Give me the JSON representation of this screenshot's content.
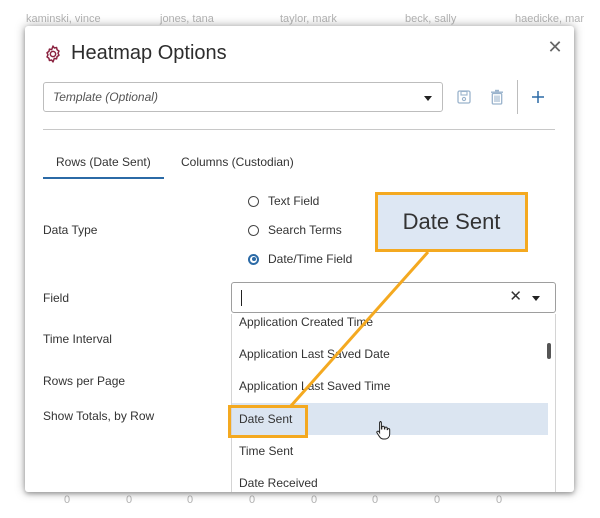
{
  "background": {
    "header_names": [
      "kaminski, vince",
      "jones, tana",
      "taylor, mark",
      "beck, sally",
      "haedicke, mar"
    ],
    "footer_values": [
      "0",
      "0",
      "0",
      "0",
      "0",
      "0",
      "0",
      "0"
    ]
  },
  "dialog": {
    "title": "Heatmap Options",
    "title_icon": "gear-icon",
    "template_placeholder": "Template (Optional)",
    "tabs": [
      {
        "label": "Rows (Date Sent)",
        "active": true
      },
      {
        "label": "Columns (Custodian)",
        "active": false
      }
    ],
    "labels": {
      "data_type": "Data Type",
      "field": "Field",
      "time_interval": "Time Interval",
      "rows_per_page": "Rows per Page",
      "show_totals": "Show Totals, by Row"
    },
    "data_type_options": [
      {
        "label": "Text Field",
        "checked": false
      },
      {
        "label": "Search Terms",
        "checked": false
      },
      {
        "label": "Date/Time Field",
        "checked": true
      }
    ],
    "field_value": "",
    "field_options": [
      "Application Created Time",
      "Application Last Saved Date",
      "Application Last Saved Time",
      "Date Sent",
      "Time Sent",
      "Date Received"
    ],
    "highlighted_option": "Date Sent"
  },
  "callout": {
    "text": "Date Sent"
  },
  "colors": {
    "accent": "#2b6aa6",
    "callout_border": "#f4a920",
    "callout_fill": "#dde7f3",
    "highlight_row": "#dbe5f1",
    "title_icon": "#8b2340"
  }
}
